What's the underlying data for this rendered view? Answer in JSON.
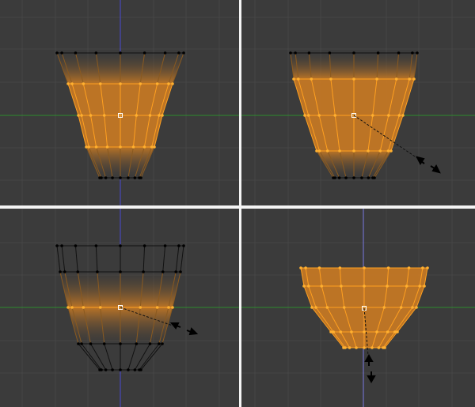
{
  "colors": {
    "background": "#3b3b3b",
    "grid": "#464646",
    "separator": "#f4f4f4",
    "x_axis": "#2e8b2e",
    "z_axis": "#4a4ad0",
    "edge": "#111111",
    "vertex": "#000000",
    "selected_edge": "#ffa020",
    "selected_face": "#c87a24",
    "selected_vertex": "#ffb030",
    "pivot": "#ffffff",
    "cursor": "#000000"
  },
  "viewports": [
    {
      "label": "top-left",
      "operation": "none"
    },
    {
      "label": "top-right",
      "operation": "scale"
    },
    {
      "label": "bottom-left",
      "operation": "scale"
    },
    {
      "label": "bottom-right",
      "operation": "move-vertical"
    }
  ],
  "icons": {
    "pivot": "pivot-point-icon",
    "scale_cursor": "scale-cursor-icon",
    "move_cursor": "vertical-move-cursor-icon"
  }
}
